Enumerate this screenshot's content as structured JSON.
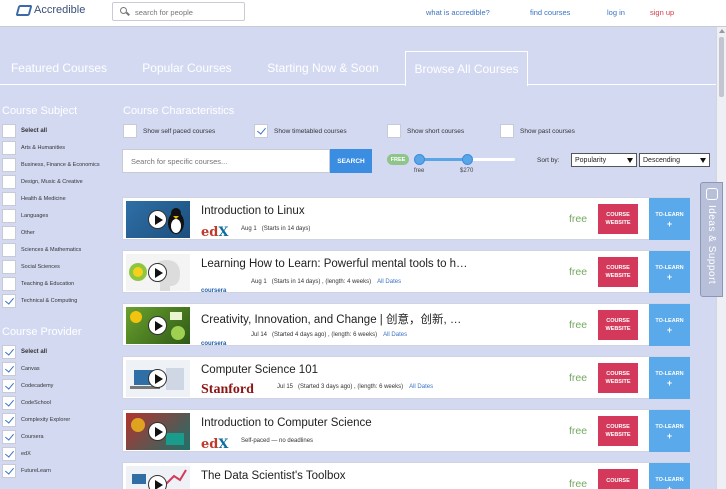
{
  "header": {
    "logo_text": "Accredible",
    "search_placeholder": "search for people",
    "links": [
      "what is accredible?",
      "find courses",
      "log in",
      "sign up"
    ]
  },
  "tabs": [
    "Featured Courses",
    "Popular Courses",
    "Starting Now & Soon",
    "Browse All Courses"
  ],
  "active_tab": "Browse All Courses",
  "sidebar": {
    "subject_heading": "Course Subject",
    "subjects": [
      {
        "label": "Select all",
        "checked": false
      },
      {
        "label": "Arts & Humanities",
        "checked": false
      },
      {
        "label": "Business, Finance & Economics",
        "checked": false
      },
      {
        "label": "Design, Music & Creative",
        "checked": false
      },
      {
        "label": "Health & Medicine",
        "checked": false
      },
      {
        "label": "Languages",
        "checked": false
      },
      {
        "label": "Other",
        "checked": false
      },
      {
        "label": "Sciences & Mathematics",
        "checked": false
      },
      {
        "label": "Social Sciences",
        "checked": false
      },
      {
        "label": "Teaching & Education",
        "checked": false
      },
      {
        "label": "Technical & Computing",
        "checked": true
      }
    ],
    "provider_heading": "Course Provider",
    "providers": [
      {
        "label": "Select all",
        "checked": true
      },
      {
        "label": "Canvas",
        "checked": true
      },
      {
        "label": "Codecademy",
        "checked": true
      },
      {
        "label": "CodeSchool",
        "checked": true
      },
      {
        "label": "Complexity Explorer",
        "checked": true
      },
      {
        "label": "Coursera",
        "checked": true
      },
      {
        "label": "edX",
        "checked": true
      },
      {
        "label": "FutureLearn",
        "checked": true
      }
    ]
  },
  "characteristics": {
    "heading": "Course Characteristics",
    "options": [
      {
        "label": "Show self paced courses",
        "checked": false
      },
      {
        "label": "Show timetabled courses",
        "checked": true
      },
      {
        "label": "Show short courses",
        "checked": false
      },
      {
        "label": "Show past courses",
        "checked": false
      }
    ],
    "search_placeholder": "Search for specific courses...",
    "search_button": "SEARCH",
    "price": {
      "pill": "FREE",
      "min_label": "free",
      "max_label": "$270"
    },
    "sort": {
      "label": "Sort by:",
      "field": "Popularity",
      "order": "Descending"
    }
  },
  "courses": [
    {
      "title": "Introduction to Linux",
      "provider": "edX",
      "date": "Aug 1",
      "details": "(Starts in 14 days)",
      "all_dates": "",
      "price": "free",
      "site_button": "COURSE WEBSITE",
      "learn_button": "TO-LEARN",
      "thumb": "linux-penguin"
    },
    {
      "title": "Learning How to Learn: Powerful mental tools to h…",
      "provider": "coursera",
      "date": "Aug 1",
      "details": "(Starts in 14 days) , (length: 4 weeks)",
      "all_dates": "All Dates",
      "price": "free",
      "site_button": "COURSE WEBSITE",
      "learn_button": "TO-LEARN",
      "thumb": "learning-head",
      "thumb_text": "ning\nLearn"
    },
    {
      "title": "Creativity, Innovation, and Change | 创意，创新, …",
      "provider": "coursera",
      "date": "Jul 14",
      "details": "(Started 4 days ago) , (length: 6 weeks)",
      "all_dates": "All Dates",
      "price": "free",
      "site_button": "COURSE WEBSITE",
      "learn_button": "TO-LEARN",
      "thumb": "creativity"
    },
    {
      "title": "Computer Science 101",
      "provider": "Stanford",
      "date": "Jul 15",
      "details": "(Started 3 days ago) , (length: 6 weeks)",
      "all_dates": "All Dates",
      "price": "free",
      "site_button": "COURSE WEBSITE",
      "learn_button": "TO-LEARN",
      "thumb": "cs-laptop"
    },
    {
      "title": "Introduction to Computer Science",
      "provider": "edX",
      "date": "",
      "details": "Self-paced — no deadlines",
      "all_dates": "",
      "price": "free",
      "site_button": "COURSE WEBSITE",
      "learn_button": "TO-LEARN",
      "thumb": "cs50"
    },
    {
      "title": "The Data Scientist's Toolbox",
      "provider": "",
      "date": "",
      "details": "",
      "all_dates": "",
      "price": "free",
      "site_button": "COURSE",
      "learn_button": "TO-LEARN",
      "thumb": "data-toolbox"
    }
  ],
  "side_tab": {
    "label": "Ideas & Support",
    "icon": "lightbulb-icon"
  },
  "colors": {
    "accent": "#3a8de0",
    "site_button": "#d4395b",
    "learn_button": "#5aa9ea",
    "free": "#74a862",
    "background": "#d4d9f2"
  }
}
